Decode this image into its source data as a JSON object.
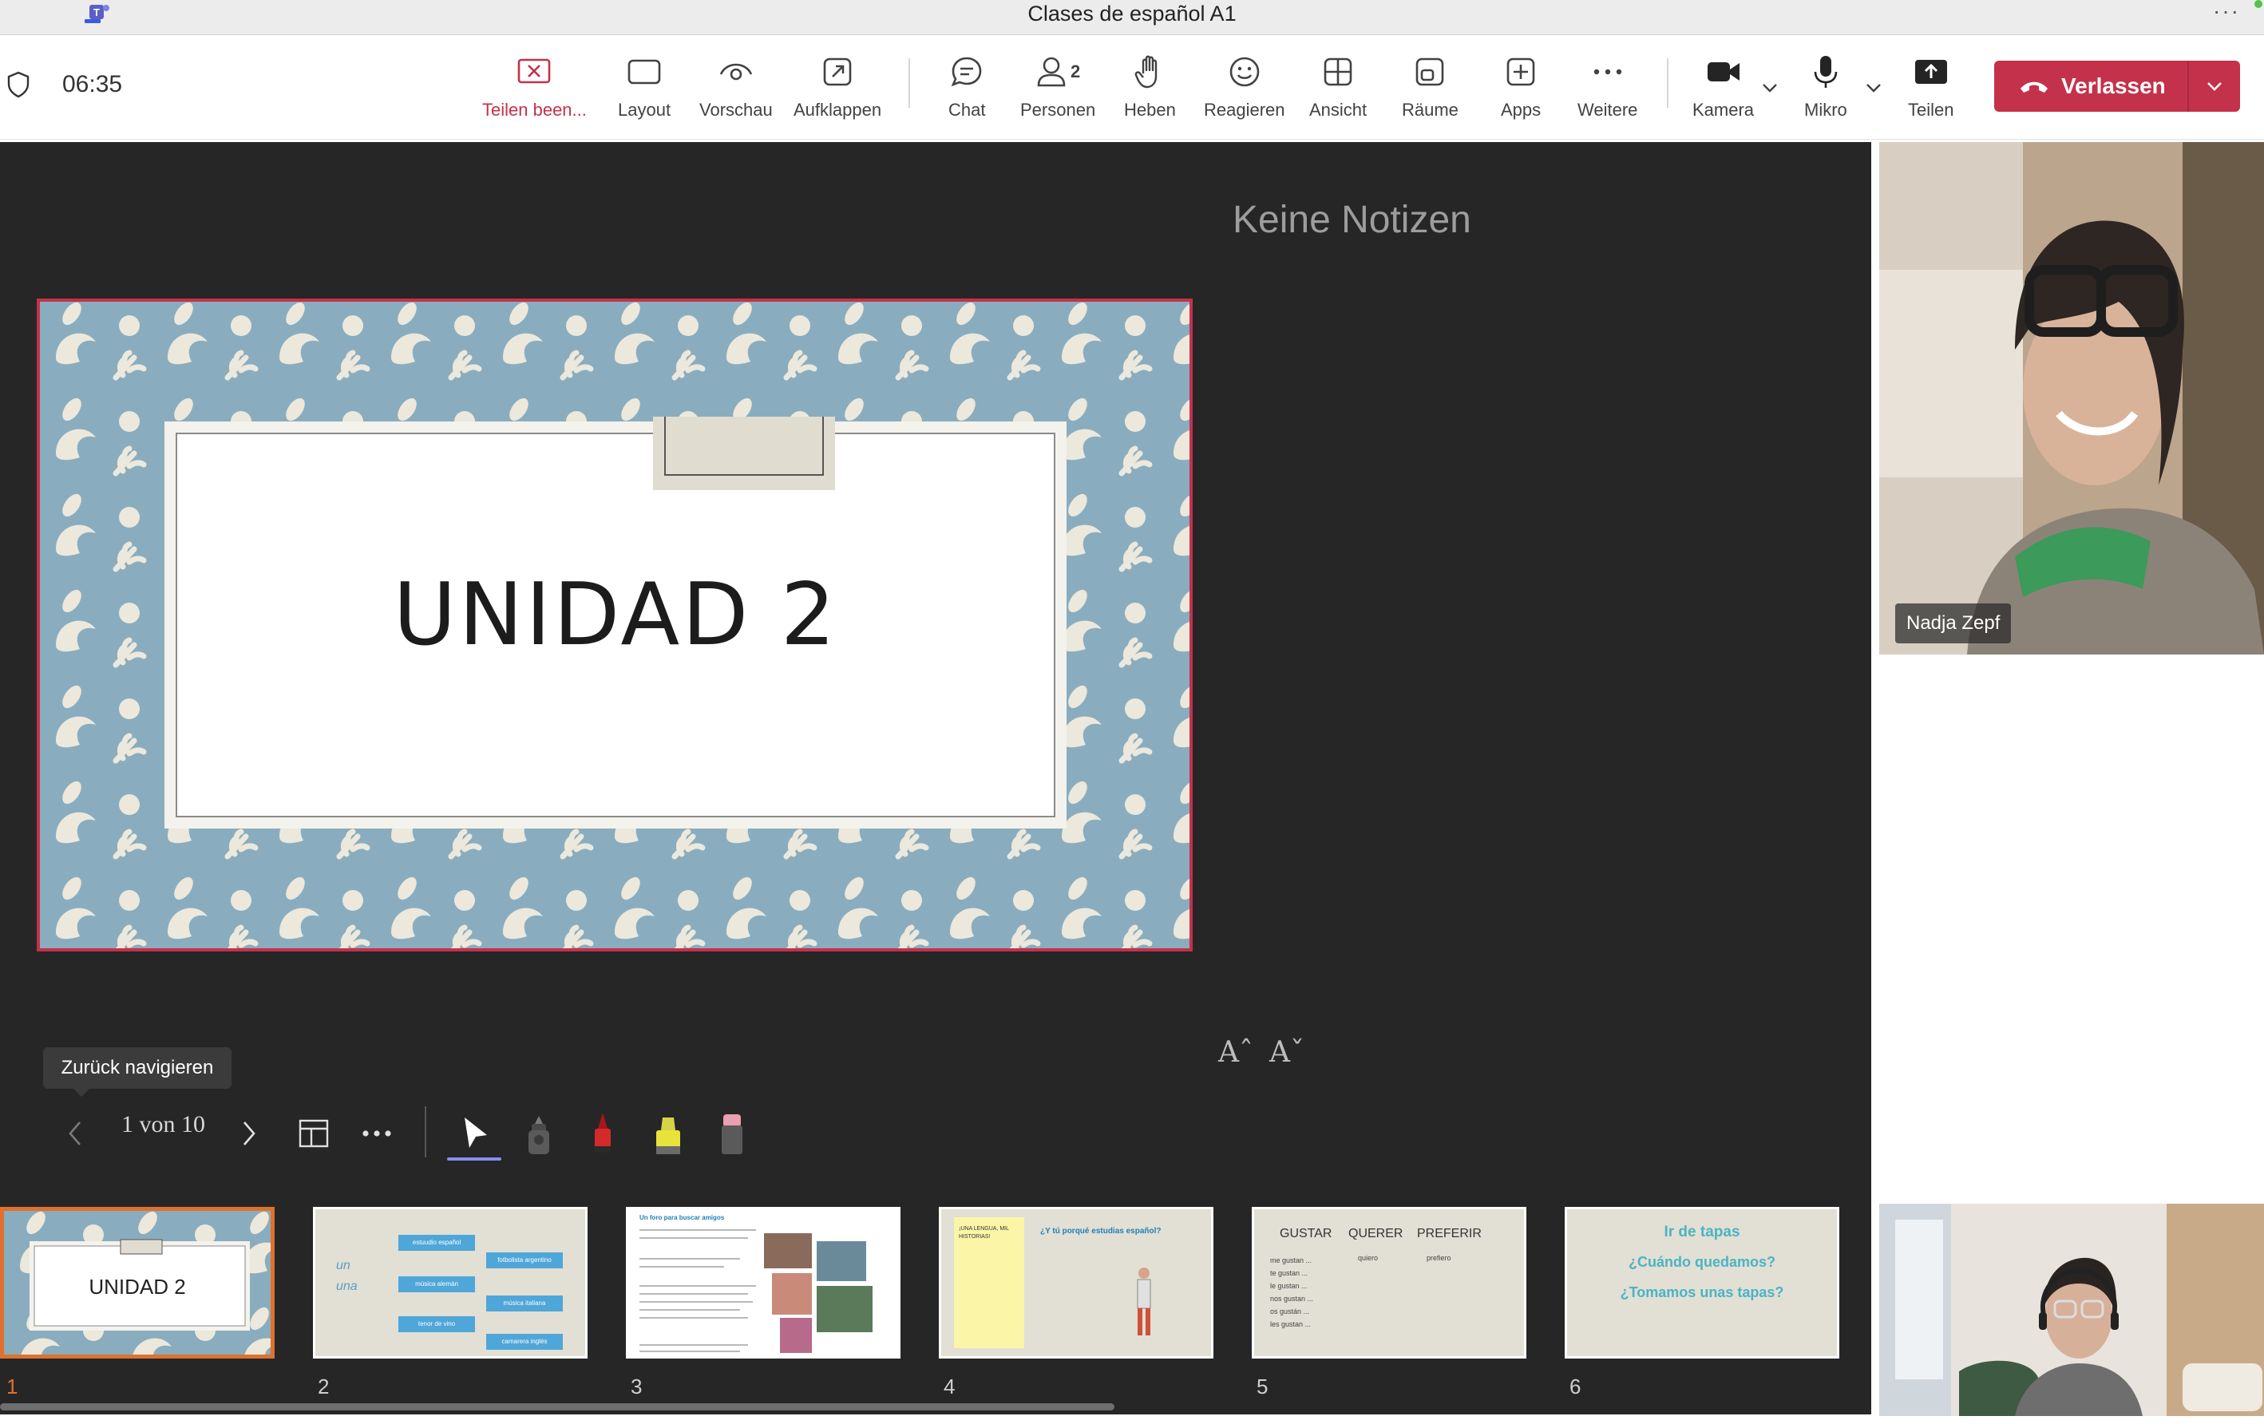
{
  "window": {
    "title": "Clases de español A1"
  },
  "toolbar": {
    "timer": "06:35",
    "stop_sharing": "Teilen been...",
    "layout": "Layout",
    "preview": "Vorschau",
    "popout": "Aufklappen",
    "chat": "Chat",
    "people": "Personen",
    "people_count": "2",
    "raise": "Heben",
    "react": "Reagieren",
    "view": "Ansicht",
    "rooms": "Räume",
    "apps": "Apps",
    "more": "Weitere",
    "camera": "Kamera",
    "mic": "Mikro",
    "share": "Teilen",
    "leave": "Verlassen"
  },
  "presenter": {
    "notes": "Keine Notizen",
    "slide_title": "UNIDAD 2",
    "font_increase": "Aˆ",
    "font_decrease": "Aˇ",
    "tooltip": "Zurück navigieren",
    "page_indicator": "1 von 10"
  },
  "thumbnails": [
    {
      "num": "1",
      "title": "UNIDAD 2"
    },
    {
      "num": "2",
      "left_text": [
        "un",
        "una"
      ],
      "chips": [
        "estuudio español",
        "música alemán",
        "tenor de vino",
        "fotbolista argentino",
        "música italiana",
        "camarera inglés"
      ]
    },
    {
      "num": "3",
      "heading": "Un foro para buscar amigos"
    },
    {
      "num": "4",
      "heading": "¿Y tú porqué estudias español?",
      "note": "¡UNA LENGUA, MIL HISTORIAS!"
    },
    {
      "num": "5",
      "headers": [
        "GUSTAR",
        "QUERER",
        "PREFERIR"
      ],
      "rows": [
        "me gustan ...",
        "te gustan ...",
        "le gustan ...",
        "nos gustan ...",
        "os gustán ...",
        "les gustan ..."
      ],
      "col2": "quiero",
      "col3": "prefiero"
    },
    {
      "num": "6",
      "lines": [
        "Ir de tapas",
        "¿Cuándo quedamos?",
        "¿Tomamos unas tapas?"
      ]
    }
  ],
  "participants": [
    {
      "name": "Nadja Zepf"
    }
  ],
  "colors": {
    "accent_red": "#c4314b",
    "stage_bg": "#262626",
    "thumb_active": "#e0712c",
    "pen_underline": "#8b8cf0"
  }
}
